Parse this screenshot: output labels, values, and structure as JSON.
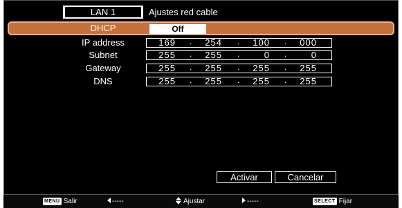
{
  "header": {
    "tab_label": "LAN 1",
    "title": "Ajustes red cable"
  },
  "rows": [
    {
      "label": "DHCP",
      "value": "Off"
    },
    {
      "label": "IP address",
      "octets": [
        "169",
        "254",
        "100",
        "000"
      ]
    },
    {
      "label": "Subnet",
      "octets": [
        "255",
        "255",
        "0",
        "0"
      ]
    },
    {
      "label": "Gateway",
      "octets": [
        "255",
        "255",
        "255",
        "255"
      ]
    },
    {
      "label": "DNS",
      "octets": [
        "255",
        "255",
        "255",
        "255"
      ]
    }
  ],
  "buttons": {
    "activate": "Activar",
    "cancel": "Cancelar"
  },
  "footer": {
    "menu_key": "MENU",
    "menu_label": "Salir",
    "left_label": "-----",
    "updown_label": "Ajustar",
    "right_label": "-----",
    "select_key": "SELECT",
    "select_label": "Fijar"
  },
  "colors": {
    "highlight": "#c8703a",
    "highlight_border": "#e8b48a",
    "background": "#000000"
  }
}
